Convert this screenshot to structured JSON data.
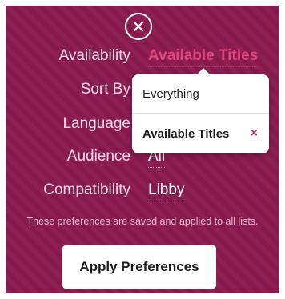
{
  "close_icon": "close-icon",
  "rows": {
    "availability": {
      "label": "Availability",
      "value": "Available Titles"
    },
    "sort_by": {
      "label": "Sort By",
      "value": ""
    },
    "language": {
      "label": "Language",
      "value": ""
    },
    "audience": {
      "label": "Audience",
      "value": "All"
    },
    "compatibility": {
      "label": "Compatibility",
      "value": "Libby"
    }
  },
  "note": "These preferences are saved and applied to all lists.",
  "apply_label": "Apply Preferences",
  "dropdown": {
    "options": [
      {
        "label": "Everything"
      },
      {
        "label": "Available Titles",
        "selected_mark": "×"
      }
    ]
  },
  "colors": {
    "panel": "#8a1a4e",
    "accent": "#e0457f",
    "selected_x": "#b3245f"
  }
}
